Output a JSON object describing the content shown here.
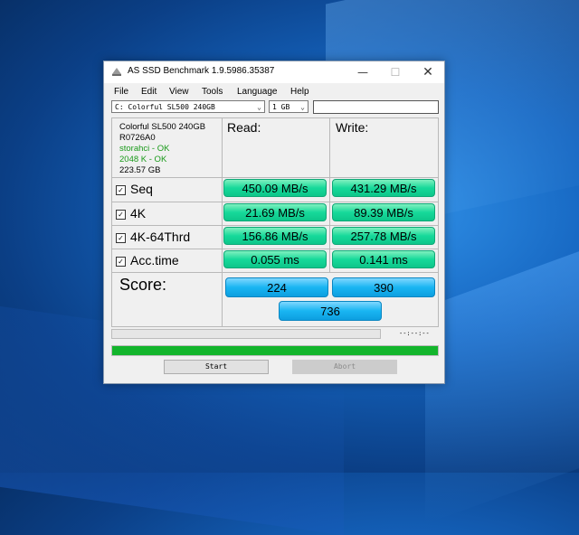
{
  "window": {
    "title": "AS SSD Benchmark 1.9.5986.35387",
    "minimize_glyph": "—",
    "maximize_glyph": "☐",
    "close_glyph": "✕"
  },
  "menu": [
    "File",
    "Edit",
    "View",
    "Tools",
    "Language",
    "Help"
  ],
  "toolbar": {
    "drive": "C: Colorful SL500 240GB",
    "size": "1 GB",
    "extra_value": ""
  },
  "drive_info": {
    "name": "Colorful SL500 240GB",
    "firmware": "R0726A0",
    "driver_status": "storahci - OK",
    "alignment_status": "2048 K - OK",
    "capacity": "223.57 GB"
  },
  "headers": {
    "read": "Read:",
    "write": "Write:"
  },
  "tests": [
    {
      "label": "Seq",
      "checked": true,
      "read": "450.09 MB/s",
      "write": "431.29 MB/s"
    },
    {
      "label": "4K",
      "checked": true,
      "read": "21.69 MB/s",
      "write": "89.39 MB/s"
    },
    {
      "label": "4K-64Thrd",
      "checked": true,
      "read": "156.86 MB/s",
      "write": "257.78 MB/s"
    },
    {
      "label": "Acc.time",
      "checked": true,
      "read": "0.055 ms",
      "write": "0.141 ms"
    }
  ],
  "score": {
    "label": "Score:",
    "read": "224",
    "write": "390",
    "total": "736"
  },
  "status": {
    "elapsed": "--:--:--",
    "progress": 1.0
  },
  "buttons": {
    "start": "Start",
    "abort": "Abort"
  },
  "colors": {
    "result_green": "#16d99a",
    "score_blue": "#19b5f2",
    "progress_green": "#13b52c"
  }
}
